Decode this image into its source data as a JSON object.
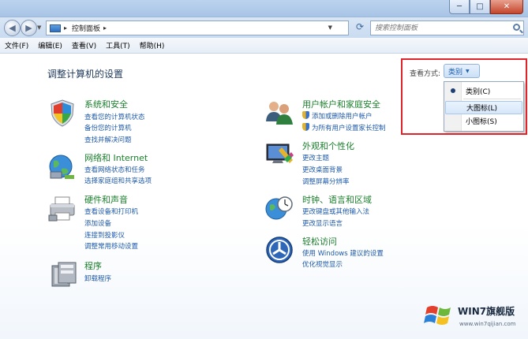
{
  "window": {
    "min_glyph": "─",
    "max_glyph": "□",
    "close_glyph": "✕"
  },
  "nav": {
    "back_glyph": "◀",
    "forward_glyph": "▶",
    "address_path": "控制面板",
    "address_sep": "▸",
    "address_end": "▸",
    "search_placeholder": "搜索控制面板"
  },
  "menu": [
    "文件(F)",
    "编辑(E)",
    "查看(V)",
    "工具(T)",
    "帮助(H)"
  ],
  "page": {
    "title": "调整计算机的设置",
    "view_by_label": "查看方式:",
    "view_by_value": "类别"
  },
  "view_menu": {
    "items": [
      "类别(C)",
      "大图标(L)",
      "小图标(S)"
    ],
    "selected": "类别(C)",
    "hovered": "大图标(L)"
  },
  "categories": {
    "system": {
      "title": "系统和安全",
      "links": [
        "查看您的计算机状态",
        "备份您的计算机",
        "查找并解决问题"
      ]
    },
    "network": {
      "title": "网络和 Internet",
      "links": [
        "查看网络状态和任务",
        "选择家庭组和共享选项"
      ]
    },
    "hardware": {
      "title": "硬件和声音",
      "links": [
        "查看设备和打印机",
        "添加设备",
        "连接到投影仪",
        "调整常用移动设置"
      ]
    },
    "programs": {
      "title": "程序",
      "links": [
        "卸载程序"
      ]
    },
    "users": {
      "title": "用户帐户和家庭安全",
      "links": [
        "添加或删除用户帐户",
        "为所有用户设置家长控制"
      ]
    },
    "appearance": {
      "title": "外观和个性化",
      "links": [
        "更改主题",
        "更改桌面背景",
        "调整屏幕分辨率"
      ]
    },
    "clock": {
      "title": "时钟、语言和区域",
      "links": [
        "更改键盘或其他输入法",
        "更改显示语言"
      ]
    },
    "ease": {
      "title": "轻松访问",
      "links": [
        "使用 Windows 建议的设置",
        "优化视觉显示"
      ]
    }
  },
  "watermark": {
    "text": "WIN7旗舰版",
    "url": "www.win7qijian.com"
  },
  "colors": {
    "highlight_box": "#e0232b",
    "category_title": "#1a7f2c",
    "link": "#1f5ba9"
  }
}
